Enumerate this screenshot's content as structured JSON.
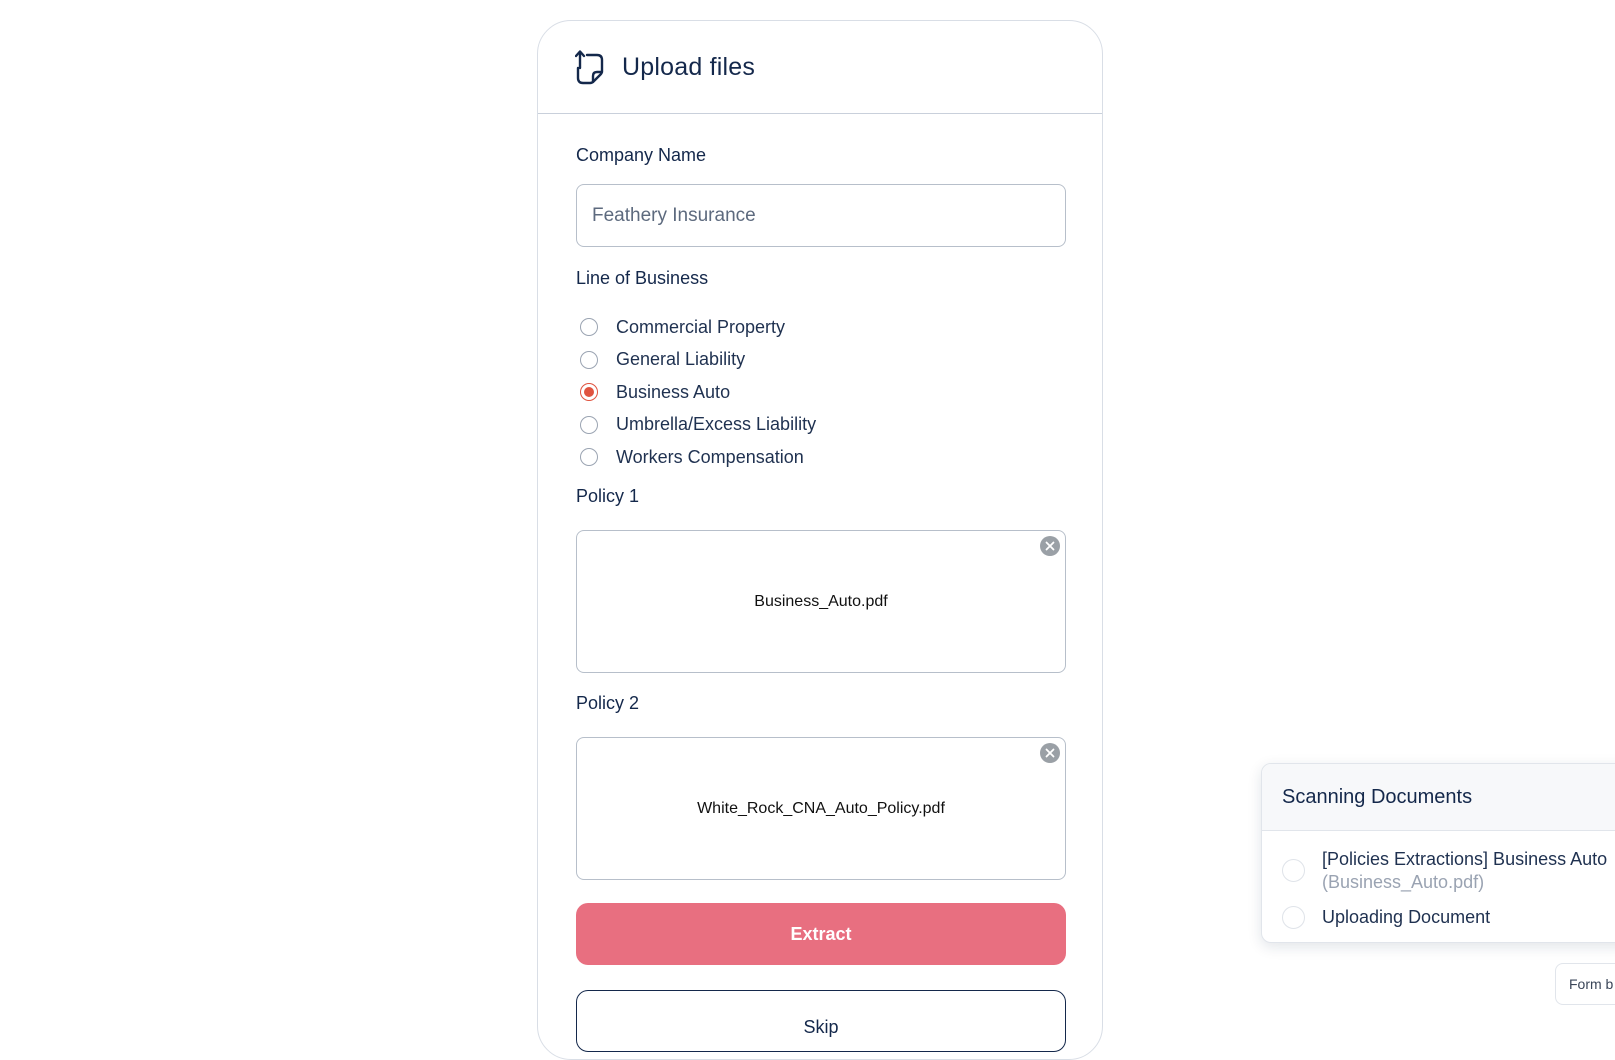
{
  "header": {
    "title": "Upload files",
    "icon": "file-upload-icon"
  },
  "company": {
    "label": "Company Name",
    "value": "Feathery Insurance"
  },
  "line_of_business": {
    "label": "Line of Business",
    "selected": "Business Auto",
    "options": [
      "Commercial Property",
      "General Liability",
      "Business Auto",
      "Umbrella/Excess Liability",
      "Workers Compensation"
    ]
  },
  "policy1": {
    "label": "Policy 1",
    "filename": "Business_Auto.pdf"
  },
  "policy2": {
    "label": "Policy 2",
    "filename": "White_Rock_CNA_Auto_Policy.pdf"
  },
  "buttons": {
    "extract": "Extract",
    "skip": "Skip"
  },
  "scanning": {
    "title": "Scanning Documents",
    "items": [
      {
        "title": "[Policies Extractions] Business Auto",
        "subtitle": "(Business_Auto.pdf)"
      },
      {
        "title": "Uploading Document"
      }
    ]
  },
  "badge": {
    "text": "Form b"
  },
  "colors": {
    "accent": "#e0533f",
    "extract_button": "#e86f80",
    "text_primary": "#14284b"
  }
}
